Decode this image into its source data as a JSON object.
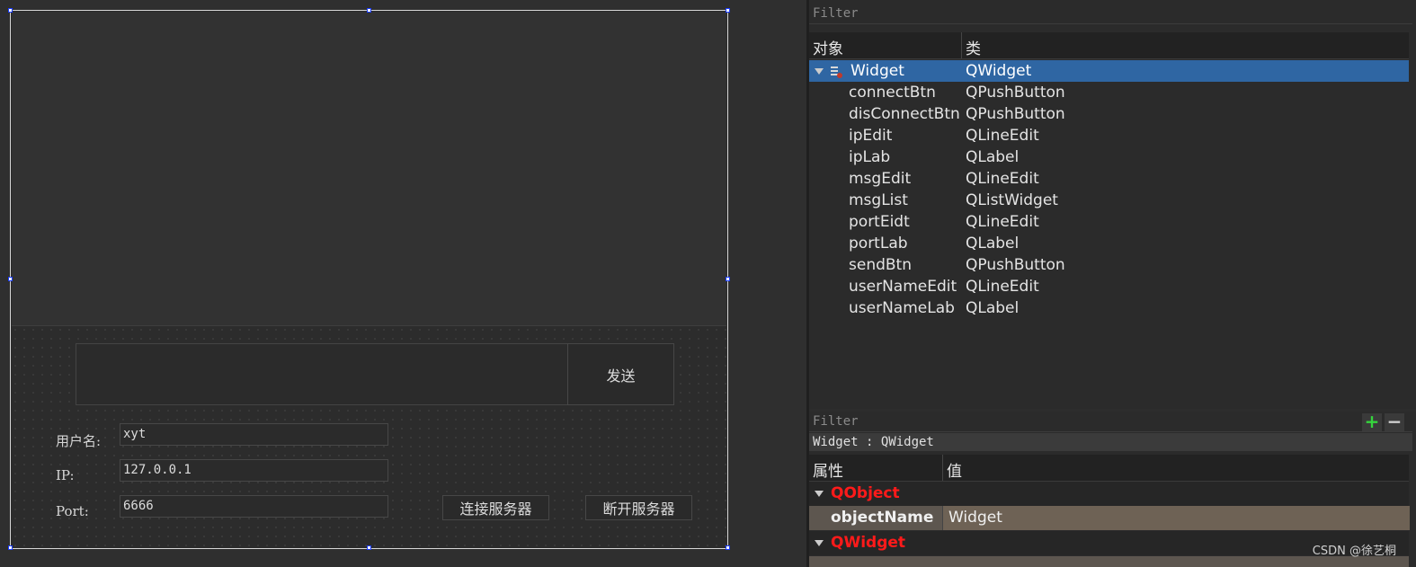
{
  "form": {
    "send_button": "发送",
    "username_label": "用户名:",
    "username_value": "xyt",
    "ip_label": "IP:",
    "ip_value": "127.0.0.1",
    "port_label": "Port:",
    "port_value": "6666",
    "connect_button": "连接服务器",
    "disconnect_button": "断开服务器"
  },
  "object_inspector": {
    "filter_placeholder": "Filter",
    "col_object": "对象",
    "col_class": "类",
    "root": {
      "name": "Widget",
      "class": "QWidget"
    },
    "children": [
      {
        "name": "connectBtn",
        "class": "QPushButton"
      },
      {
        "name": "disConnectBtn",
        "class": "QPushButton"
      },
      {
        "name": "ipEdit",
        "class": "QLineEdit"
      },
      {
        "name": "ipLab",
        "class": "QLabel"
      },
      {
        "name": "msgEdit",
        "class": "QLineEdit"
      },
      {
        "name": "msgList",
        "class": "QListWidget"
      },
      {
        "name": "portEidt",
        "class": "QLineEdit"
      },
      {
        "name": "portLab",
        "class": "QLabel"
      },
      {
        "name": "sendBtn",
        "class": "QPushButton"
      },
      {
        "name": "userNameEdit",
        "class": "QLineEdit"
      },
      {
        "name": "userNameLab",
        "class": "QLabel"
      }
    ]
  },
  "property_editor": {
    "filter_placeholder": "Filter",
    "current_object": "Widget : QWidget",
    "col_property": "属性",
    "col_value": "值",
    "group_qobject": "QObject",
    "object_name_label": "objectName",
    "object_name_value": "Widget",
    "group_qwidget": "QWidget"
  },
  "watermark": "CSDN @徐艺桐",
  "colors": {
    "selection": "#2f66a3",
    "group_text": "#ff1a1a",
    "prop_value_bg": "#6e6255"
  }
}
